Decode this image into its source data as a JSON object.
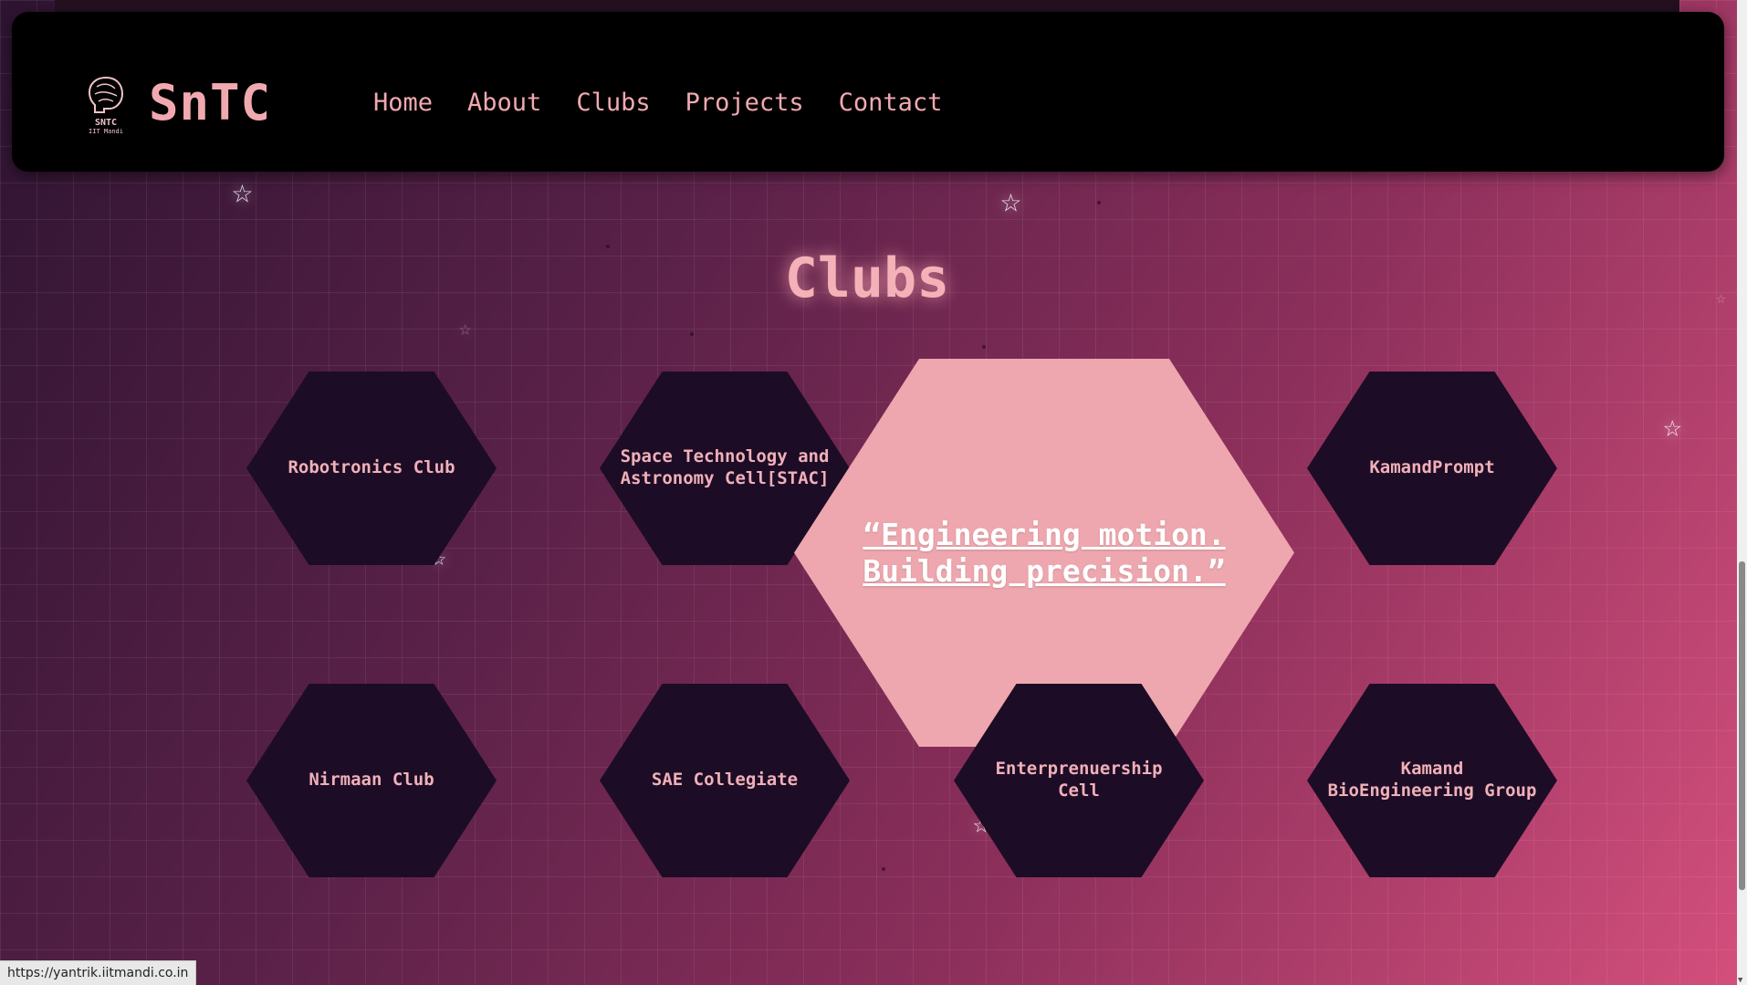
{
  "header": {
    "logo_line1": "SNTC",
    "logo_line2": "IIT Mandi",
    "brand": "SnTC",
    "nav": [
      "Home",
      "About",
      "Clubs",
      "Projects",
      "Contact"
    ]
  },
  "section": {
    "heading": "Clubs"
  },
  "clubs": [
    "Robotronics Club",
    "Space Technology and Astronomy Cell[STAC]",
    "KamandPrompt",
    "Nirmaan Club",
    "SAE Collegiate",
    "Enterprenuership Cell",
    "Kamand BioEngineering Group"
  ],
  "featured": {
    "quote": "“Engineering motion. Building precision.”"
  },
  "status": {
    "url": "https://yantrik.iitmandi.co.in"
  },
  "colors": {
    "accent": "#f1a9b0",
    "hex_dark": "#1d0c26",
    "hex_highlight": "#eea7ae",
    "navbar": "#000000"
  },
  "icons": [
    "brain-logo-icon",
    "star-icon"
  ]
}
